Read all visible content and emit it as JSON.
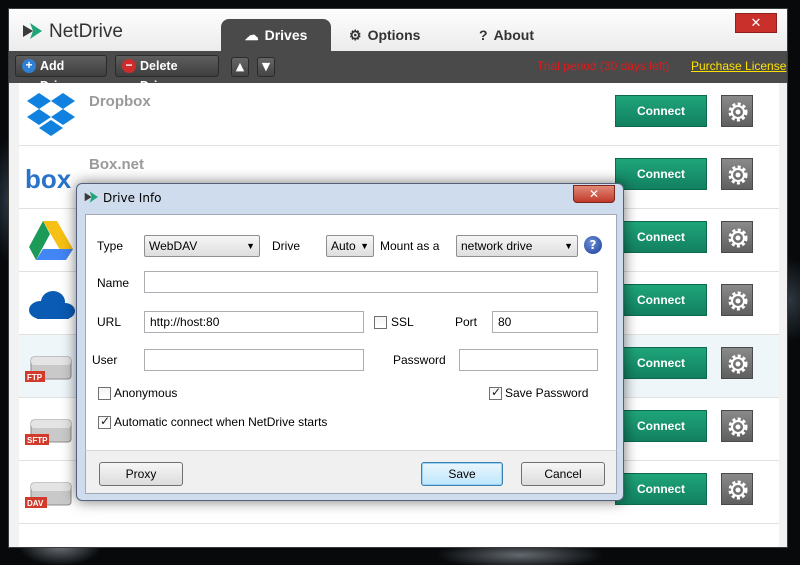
{
  "app": {
    "title": "NetDrive"
  },
  "tabs": [
    {
      "label": "Drives",
      "icon": "cloud-icon"
    },
    {
      "label": "Options",
      "icon": "gear-icon"
    },
    {
      "label": "About",
      "icon": "question-icon"
    }
  ],
  "toolbar": {
    "add_label": "Add Drive",
    "delete_label": "Delete Drive",
    "trial_text": "Trial period (30 days left)",
    "purchase_text": "Purchase License"
  },
  "drives": [
    {
      "name": "Dropbox",
      "icon": "dropbox-icon",
      "connect": "Connect"
    },
    {
      "name": "Box.net",
      "icon": "box-icon",
      "connect": "Connect"
    },
    {
      "name": "",
      "icon": "google-drive-icon",
      "connect": "Connect"
    },
    {
      "name": "",
      "icon": "onedrive-icon",
      "connect": "Connect"
    },
    {
      "name": "",
      "icon": "ftp-drive-icon",
      "connect": "Connect",
      "badge": "FTP"
    },
    {
      "name": "",
      "icon": "sftp-drive-icon",
      "connect": "Connect",
      "badge": "SFTP"
    },
    {
      "name": "",
      "icon": "dav-drive-icon",
      "connect": "Connect",
      "badge": "DAV"
    }
  ],
  "dialog": {
    "title": "Drive Info",
    "type_label": "Type",
    "type_value": "WebDAV",
    "drive_label": "Drive",
    "drive_value": "Auto",
    "mount_label": "Mount as a",
    "mount_value": "network drive",
    "name_label": "Name",
    "name_value": "",
    "url_label": "URL",
    "url_value": "http://host:80",
    "ssl_label": "SSL",
    "ssl_checked": false,
    "port_label": "Port",
    "port_value": "80",
    "user_label": "User",
    "user_value": "",
    "password_label": "Password",
    "password_value": "",
    "anonymous_label": "Anonymous",
    "anonymous_checked": false,
    "save_password_label": "Save Password",
    "save_password_checked": true,
    "auto_connect_label": "Automatic connect when NetDrive starts",
    "auto_connect_checked": true,
    "proxy_button": "Proxy",
    "save_button": "Save",
    "cancel_button": "Cancel"
  }
}
